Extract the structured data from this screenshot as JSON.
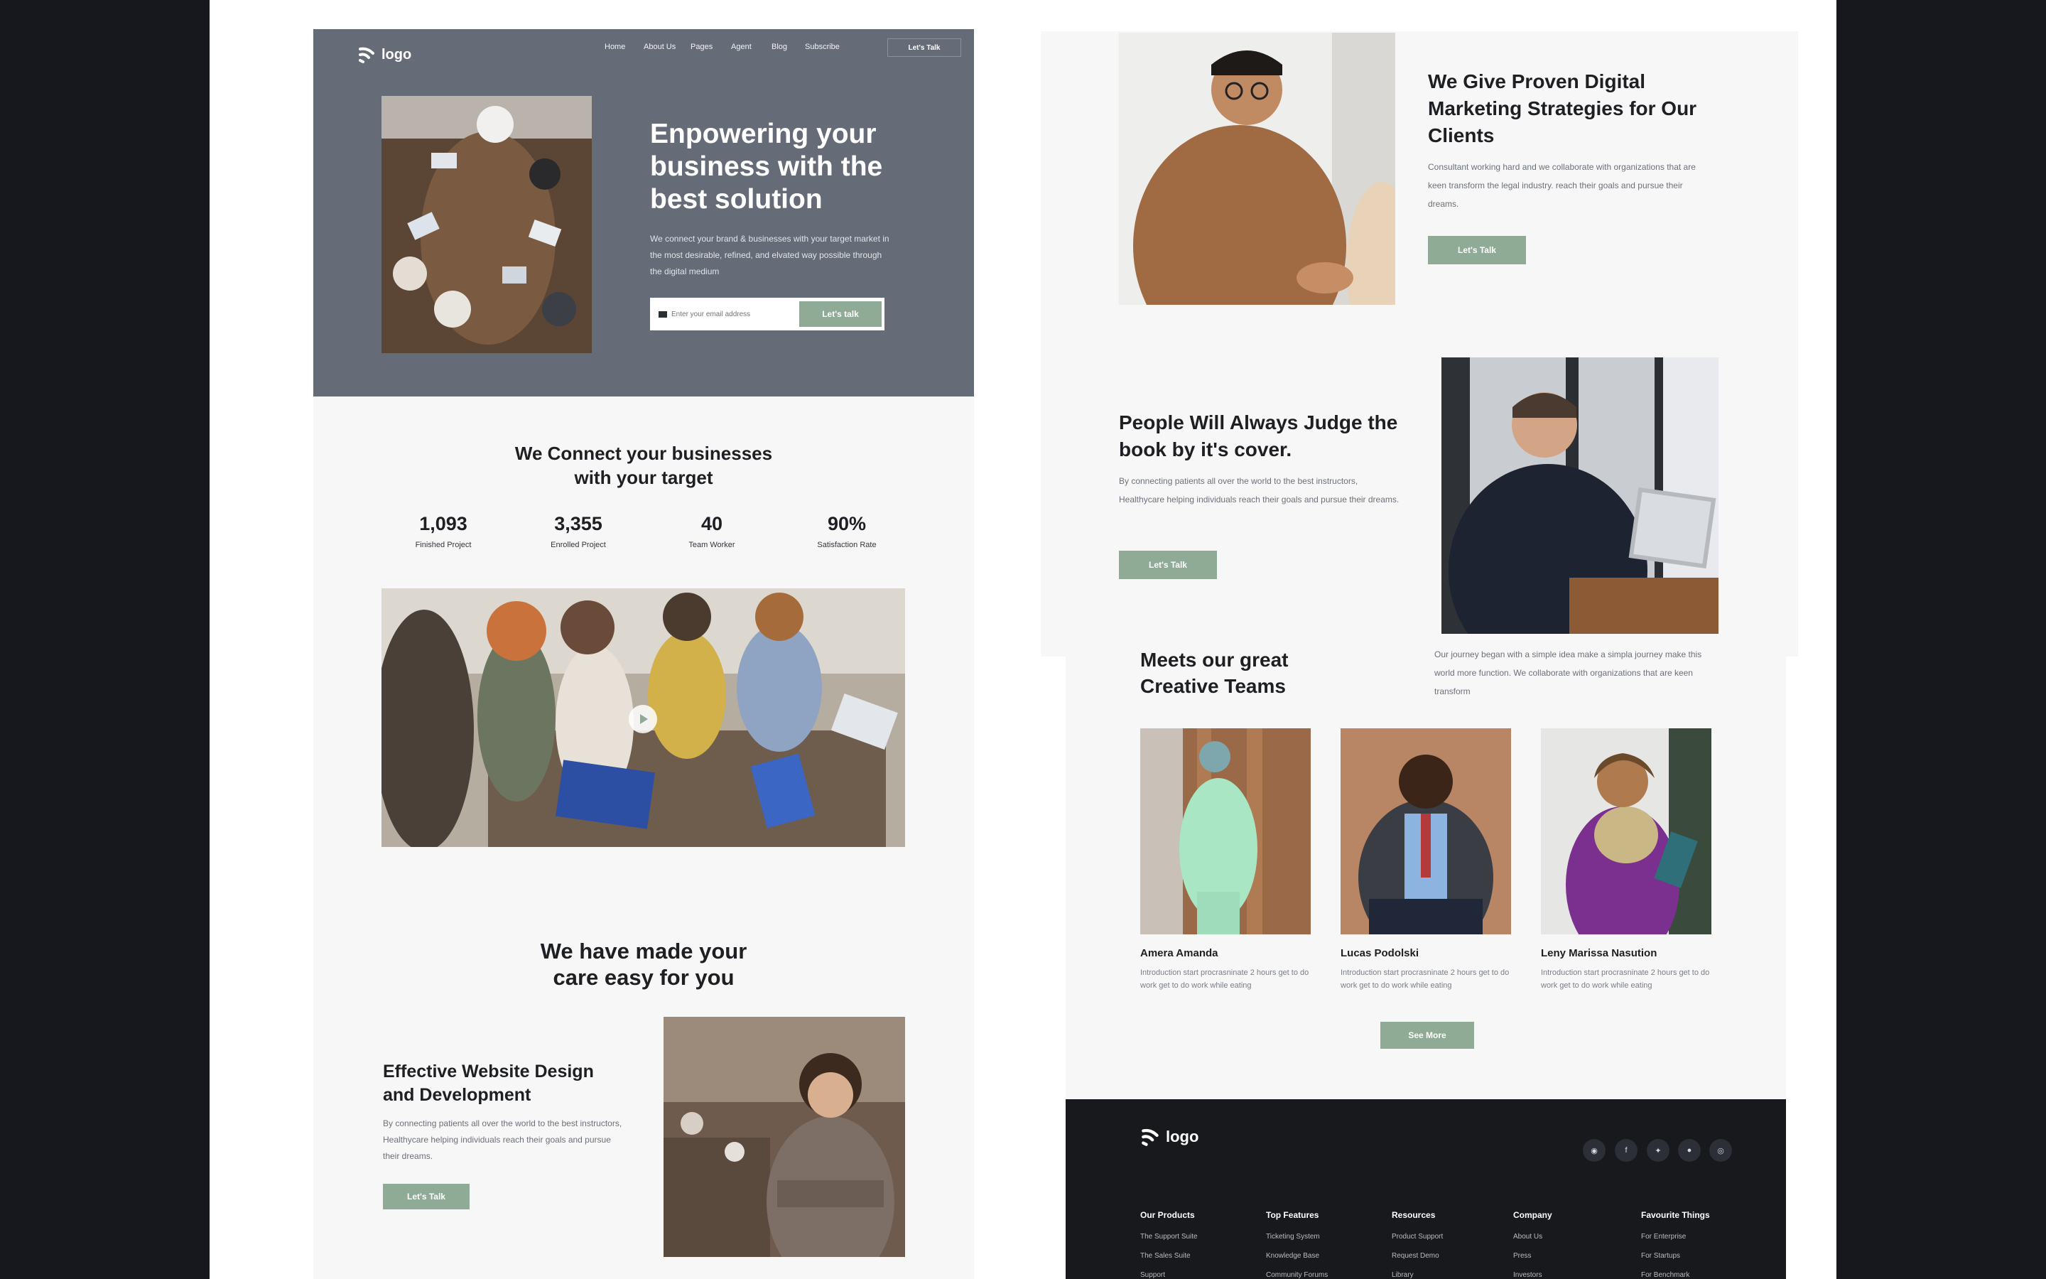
{
  "left_page": {
    "nav": {
      "logo": "logo",
      "links": [
        "Home",
        "About Us",
        "Pages",
        "Agent",
        "Blog",
        "Subscribe"
      ],
      "cta": "Let's Talk"
    },
    "hero": {
      "title": "Enpowering your business with the best solution",
      "description": "We connect your brand & businesses with your target market in the most desirable, refined, and elvated way possible through the digital medium",
      "email_placeholder": "Enter your email address",
      "cta": "Let's talk"
    },
    "connect": {
      "title": "We Connect your businesses with your target",
      "stats": [
        {
          "value": "1,093",
          "label": "Finished Project"
        },
        {
          "value": "3,355",
          "label": "Enrolled Project"
        },
        {
          "value": "40",
          "label": "Team Worker"
        },
        {
          "value": "90%",
          "label": "Satisfaction Rate"
        }
      ]
    },
    "care": {
      "title": "We have made your care easy for you",
      "feature_title": "Effective Website Design and Development",
      "feature_text": "By connecting patients all over the world to the best instructors, Healthycare helping individuals reach their goals and pursue their dreams.",
      "cta": "Let's Talk"
    }
  },
  "right_page": {
    "proven": {
      "title": "We Give Proven Digital Marketing Strategies for Our Clients",
      "text": "Consultant working hard and we collaborate with organizations that are keen transform the legal industry. reach their goals and pursue their dreams.",
      "cta": "Let's Talk"
    },
    "judge": {
      "title": "People Will Always Judge the book by it's cover.",
      "text": "By connecting patients all over the world to the best instructors, Healthycare helping individuals reach their goals and pursue their dreams.",
      "cta": "Let's Talk"
    },
    "teams": {
      "title": "Meets our great Creative Teams",
      "intro": "Our journey began with a simple idea make a simpla journey make this world more function. We collaborate with organizations that are keen transform",
      "members": [
        {
          "name": "Amera Amanda",
          "bio": "Introduction start procrasninate 2 hours get to do work get to do work while eating"
        },
        {
          "name": "Lucas Podolski",
          "bio": "Introduction start procrasninate 2 hours get to do work get to do work while eating"
        },
        {
          "name": "Leny Marissa Nasution",
          "bio": "Introduction start procrasninate 2 hours get to do work get to do work while eating"
        }
      ],
      "see_more": "See More"
    },
    "footer": {
      "logo": "logo",
      "social_icons": [
        "instagram-icon",
        "facebook-icon",
        "twitter-icon",
        "github-icon",
        "dribbble-icon"
      ],
      "columns": [
        {
          "heading": "Our Products",
          "items": [
            "The Support Suite",
            "The Sales Suite",
            "Support"
          ]
        },
        {
          "heading": "Top Features",
          "items": [
            "Ticketing System",
            "Knowledge Base",
            "Community Forums"
          ]
        },
        {
          "heading": "Resources",
          "items": [
            "Product Support",
            "Request Demo",
            "Library"
          ]
        },
        {
          "heading": "Company",
          "items": [
            "About Us",
            "Press",
            "Investors"
          ]
        },
        {
          "heading": "Favourite Things",
          "items": [
            "For Enterprise",
            "For Startups",
            "For Benchmark"
          ]
        }
      ]
    }
  },
  "colors": {
    "background": "#16181d",
    "hero_bg": "#656b77",
    "accent_green": "#8fab96",
    "footer_bg": "#17191d"
  }
}
